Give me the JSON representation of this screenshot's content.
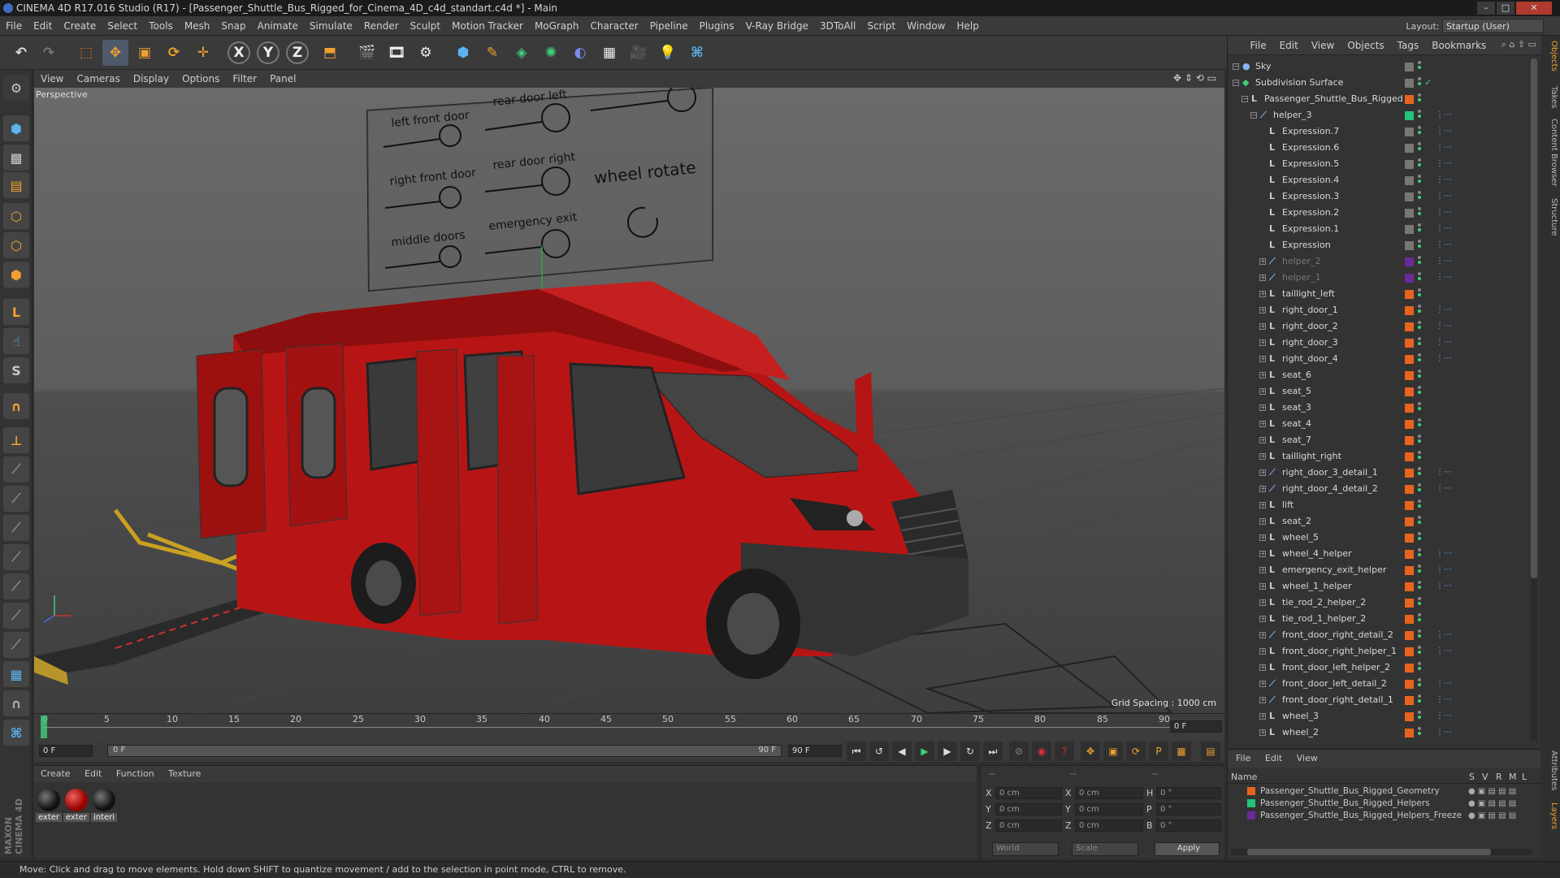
{
  "window": {
    "title": "CINEMA 4D R17.016 Studio (R17) - [Passenger_Shuttle_Bus_Rigged_for_Cinema_4D_c4d_standart.c4d *] - Main"
  },
  "menu": [
    "File",
    "Edit",
    "Create",
    "Select",
    "Tools",
    "Mesh",
    "Snap",
    "Animate",
    "Simulate",
    "Render",
    "Sculpt",
    "Motion Tracker",
    "MoGraph",
    "Character",
    "Pipeline",
    "Plugins",
    "V-Ray Bridge",
    "3DToAll",
    "Script",
    "Window",
    "Help"
  ],
  "layout": {
    "label": "Layout:",
    "value": "Startup (User)"
  },
  "viewport": {
    "menu": [
      "View",
      "Cameras",
      "Display",
      "Options",
      "Filter",
      "Panel"
    ],
    "camera_label": "Perspective",
    "grid_spacing": "Grid Spacing : 1000 cm",
    "panel_labels": [
      "left front door",
      "rear door left",
      "right front door",
      "rear door right",
      "wheel rotate",
      "middle doors",
      "emergency exit"
    ]
  },
  "timeline": {
    "ticks": [
      "0",
      "5",
      "10",
      "15",
      "20",
      "25",
      "30",
      "35",
      "40",
      "45",
      "50",
      "55",
      "60",
      "65",
      "70",
      "75",
      "80",
      "85",
      "90"
    ],
    "current_frame": "0 F",
    "start_field": "0 F",
    "range_start": "0 F",
    "range_end": "90 F",
    "end_field": "90 F"
  },
  "materials": {
    "menu": [
      "Create",
      "Edit",
      "Function",
      "Texture"
    ],
    "items": [
      {
        "label": "exter",
        "color": "#111111"
      },
      {
        "label": "exter",
        "color": "#b01010"
      },
      {
        "label": "interi",
        "color": "#1a1a1a"
      }
    ]
  },
  "coordinates": {
    "header": [
      "--",
      "--",
      "--"
    ],
    "rows": [
      {
        "a": "X",
        "av": "0 cm",
        "b": "X",
        "bv": "0 cm",
        "c": "H",
        "cv": "0 °"
      },
      {
        "a": "Y",
        "av": "0 cm",
        "b": "Y",
        "bv": "0 cm",
        "c": "P",
        "cv": "0 °"
      },
      {
        "a": "Z",
        "av": "0 cm",
        "b": "Z",
        "bv": "0 cm",
        "c": "B",
        "cv": "0 °"
      }
    ],
    "mode": "World",
    "scale": "Scale",
    "apply": "Apply"
  },
  "objects": {
    "menu": [
      "File",
      "Edit",
      "View",
      "Objects",
      "Tags",
      "Bookmarks"
    ],
    "rows": [
      {
        "name": "Sky",
        "indent": 0,
        "icon": "sky",
        "swatch": "#777"
      },
      {
        "name": "Subdivision Surface",
        "indent": 0,
        "icon": "subd",
        "swatch": "#777"
      },
      {
        "name": "Passenger_Shuttle_Bus_Rigged",
        "indent": 1,
        "icon": "null",
        "swatch": "#e8641e"
      },
      {
        "name": "helper_3",
        "indent": 2,
        "icon": "joint",
        "swatch": "#22c37a"
      },
      {
        "name": "Expression.7",
        "indent": 3,
        "icon": "null",
        "swatch": "#777"
      },
      {
        "name": "Expression.6",
        "indent": 3,
        "icon": "null",
        "swatch": "#777"
      },
      {
        "name": "Expression.5",
        "indent": 3,
        "icon": "null",
        "swatch": "#777"
      },
      {
        "name": "Expression.4",
        "indent": 3,
        "icon": "null",
        "swatch": "#777"
      },
      {
        "name": "Expression.3",
        "indent": 3,
        "icon": "null",
        "swatch": "#777"
      },
      {
        "name": "Expression.2",
        "indent": 3,
        "icon": "null",
        "swatch": "#777"
      },
      {
        "name": "Expression.1",
        "indent": 3,
        "icon": "null",
        "swatch": "#777"
      },
      {
        "name": "Expression",
        "indent": 3,
        "icon": "null",
        "swatch": "#777"
      },
      {
        "name": "helper_2",
        "indent": 3,
        "icon": "joint",
        "swatch": "#6a2a9a",
        "dim": true
      },
      {
        "name": "helper_1",
        "indent": 3,
        "icon": "joint",
        "swatch": "#6a2a9a",
        "dim": true
      },
      {
        "name": "taillight_left",
        "indent": 3,
        "icon": "null",
        "swatch": "#e8641e"
      },
      {
        "name": "right_door_1",
        "indent": 3,
        "icon": "null",
        "swatch": "#e8641e"
      },
      {
        "name": "right_door_2",
        "indent": 3,
        "icon": "null",
        "swatch": "#e8641e"
      },
      {
        "name": "right_door_3",
        "indent": 3,
        "icon": "null",
        "swatch": "#e8641e"
      },
      {
        "name": "right_door_4",
        "indent": 3,
        "icon": "null",
        "swatch": "#e8641e"
      },
      {
        "name": "seat_6",
        "indent": 3,
        "icon": "null",
        "swatch": "#e8641e"
      },
      {
        "name": "seat_5",
        "indent": 3,
        "icon": "null",
        "swatch": "#e8641e"
      },
      {
        "name": "seat_3",
        "indent": 3,
        "icon": "null",
        "swatch": "#e8641e"
      },
      {
        "name": "seat_4",
        "indent": 3,
        "icon": "null",
        "swatch": "#e8641e"
      },
      {
        "name": "seat_7",
        "indent": 3,
        "icon": "null",
        "swatch": "#e8641e"
      },
      {
        "name": "taillight_right",
        "indent": 3,
        "icon": "null",
        "swatch": "#e8641e"
      },
      {
        "name": "right_door_3_detail_1",
        "indent": 3,
        "icon": "joint",
        "swatch": "#e8641e"
      },
      {
        "name": "right_door_4_detail_2",
        "indent": 3,
        "icon": "joint",
        "swatch": "#e8641e"
      },
      {
        "name": "lift",
        "indent": 3,
        "icon": "null",
        "swatch": "#e8641e"
      },
      {
        "name": "seat_2",
        "indent": 3,
        "icon": "null",
        "swatch": "#e8641e"
      },
      {
        "name": "wheel_5",
        "indent": 3,
        "icon": "null",
        "swatch": "#e8641e"
      },
      {
        "name": "wheel_4_helper",
        "indent": 3,
        "icon": "null",
        "swatch": "#e8641e"
      },
      {
        "name": "emergency_exit_helper",
        "indent": 3,
        "icon": "null",
        "swatch": "#e8641e"
      },
      {
        "name": "wheel_1_helper",
        "indent": 3,
        "icon": "null",
        "swatch": "#e8641e"
      },
      {
        "name": "tie_rod_2_helper_2",
        "indent": 3,
        "icon": "null",
        "swatch": "#e8641e"
      },
      {
        "name": "tie_rod_1_helper_2",
        "indent": 3,
        "icon": "null",
        "swatch": "#e8641e"
      },
      {
        "name": "front_door_right_detail_2",
        "indent": 3,
        "icon": "joint",
        "swatch": "#e8641e"
      },
      {
        "name": "front_door_right_helper_1",
        "indent": 3,
        "icon": "null",
        "swatch": "#e8641e"
      },
      {
        "name": "front_door_left_helper_2",
        "indent": 3,
        "icon": "null",
        "swatch": "#e8641e"
      },
      {
        "name": "front_door_left_detail_2",
        "indent": 3,
        "icon": "joint",
        "swatch": "#e8641e"
      },
      {
        "name": "front_door_right_detail_1",
        "indent": 3,
        "icon": "joint",
        "swatch": "#e8641e"
      },
      {
        "name": "wheel_3",
        "indent": 3,
        "icon": "null",
        "swatch": "#e8641e"
      },
      {
        "name": "wheel_2",
        "indent": 3,
        "icon": "null",
        "swatch": "#e8641e"
      }
    ]
  },
  "layers": {
    "menu": [
      "File",
      "Edit",
      "View"
    ],
    "columns": {
      "name": "Name",
      "s": "S",
      "v": "V",
      "r": "R",
      "m": "M",
      "l": "L"
    },
    "items": [
      {
        "name": "Passenger_Shuttle_Bus_Rigged_Geometry",
        "color": "#e8641e"
      },
      {
        "name": "Passenger_Shuttle_Bus_Rigged_Helpers",
        "color": "#22c37a"
      },
      {
        "name": "Passenger_Shuttle_Bus_Rigged_Helpers_Freeze",
        "color": "#6a2a9a"
      }
    ]
  },
  "right_tabs": [
    "Objects",
    "Takes",
    "Content Browser",
    "Structure",
    "Attributes",
    "Layers"
  ],
  "status": "Move: Click and drag to move elements. Hold down SHIFT to quantize movement / add to the selection in point mode, CTRL to remove.",
  "brand": "MAXON CINEMA 4D"
}
